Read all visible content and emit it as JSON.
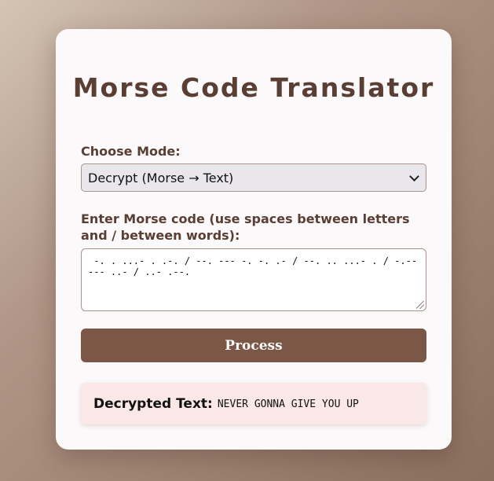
{
  "app": {
    "title": "Morse Code Translator"
  },
  "mode": {
    "label": "Choose Mode:",
    "selected": "Decrypt (Morse → Text)"
  },
  "input": {
    "label": "Enter Morse code (use spaces between letters and / between words):",
    "value": " -. . ...- . .-. / --. --- -. -. .- / --. .. ...- . / -.-- --- ..- / ..- .--."
  },
  "actions": {
    "process_label": "Process"
  },
  "result": {
    "label": "Decrypted Text:",
    "value": "NEVER GONNA GIVE YOU UP"
  },
  "colors": {
    "accent": "#7b5748",
    "title": "#5a3e33",
    "result_bg": "#fae8e6"
  }
}
